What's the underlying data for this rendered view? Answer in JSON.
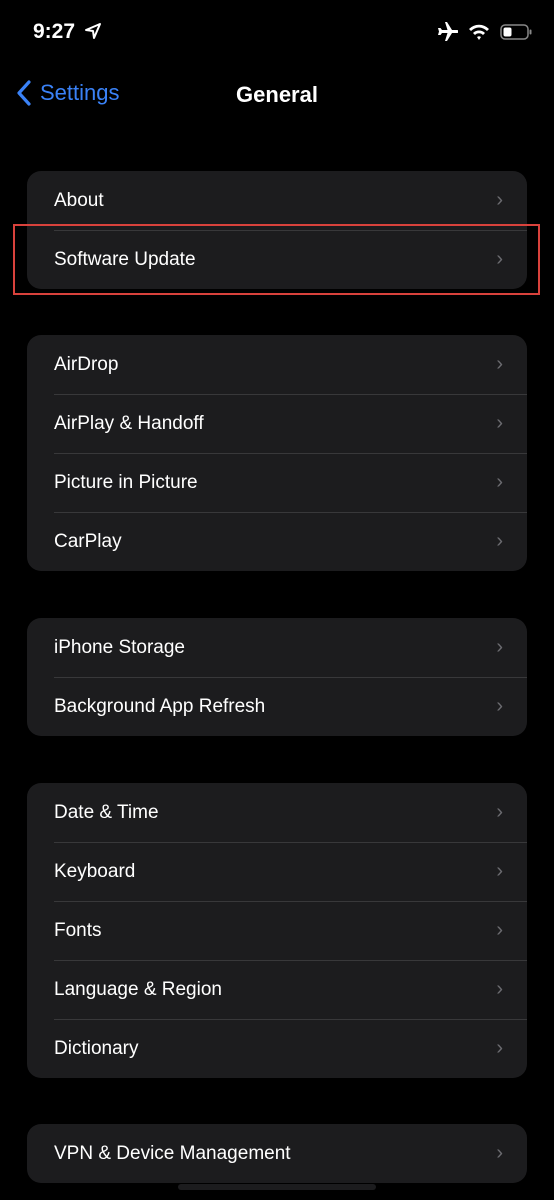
{
  "status_bar": {
    "time": "9:27",
    "icons": [
      "location-arrow-icon",
      "airplane-icon",
      "wifi-icon",
      "battery-icon"
    ],
    "battery_level": 0.35
  },
  "nav": {
    "back_label": "Settings",
    "title": "General"
  },
  "accent": "#3a82f7",
  "highlight_color": "#d9423c",
  "groups": [
    {
      "items": [
        {
          "label": "About"
        },
        {
          "label": "Software Update"
        }
      ]
    },
    {
      "items": [
        {
          "label": "AirDrop"
        },
        {
          "label": "AirPlay & Handoff"
        },
        {
          "label": "Picture in Picture"
        },
        {
          "label": "CarPlay"
        }
      ]
    },
    {
      "items": [
        {
          "label": "iPhone Storage"
        },
        {
          "label": "Background App Refresh"
        }
      ]
    },
    {
      "items": [
        {
          "label": "Date & Time"
        },
        {
          "label": "Keyboard"
        },
        {
          "label": "Fonts"
        },
        {
          "label": "Language & Region"
        },
        {
          "label": "Dictionary"
        }
      ]
    },
    {
      "items": [
        {
          "label": "VPN & Device Management"
        }
      ]
    }
  ]
}
